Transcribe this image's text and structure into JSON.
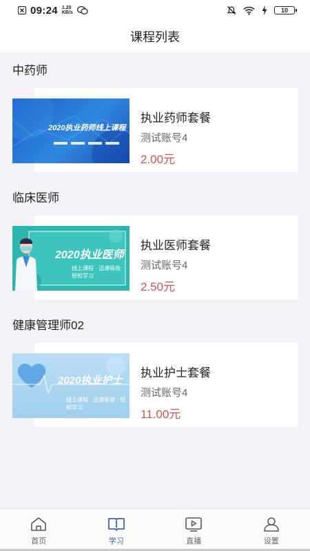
{
  "status_bar": {
    "time": "09:24",
    "speed_value": "1.20",
    "speed_unit": "KB/s",
    "battery": "10"
  },
  "header": {
    "title": "课程列表"
  },
  "sections": [
    {
      "title": "中药师",
      "course": {
        "name": "执业药师套餐",
        "account": "测试账号4",
        "price": "2.00元",
        "thumb_text": "2020执业药师线上课程"
      }
    },
    {
      "title": "临床医师",
      "course": {
        "name": "执业医师套餐",
        "account": "测试账号4",
        "price": "2.50元",
        "thumb_text": "2020执业医师",
        "thumb_sub": "线上课程 · 迅速吸收 · 轻松学习"
      }
    },
    {
      "title": "健康管理师02",
      "course": {
        "name": "执业护士套餐",
        "account": "测试账号4",
        "price": "11.00元",
        "thumb_text": "2020执业护士",
        "thumb_sub": "线上课程 · 迅速吸收 · 轻松学习"
      }
    }
  ],
  "tab_bar": [
    {
      "label": "首页",
      "icon": "home-icon",
      "active": false
    },
    {
      "label": "学习",
      "icon": "book-icon",
      "active": true
    },
    {
      "label": "直播",
      "icon": "play-icon",
      "active": false
    },
    {
      "label": "设置",
      "icon": "user-icon",
      "active": false
    }
  ],
  "colors": {
    "accent": "#4563b0",
    "price": "#d0544f",
    "background": "#f4f2f6"
  }
}
